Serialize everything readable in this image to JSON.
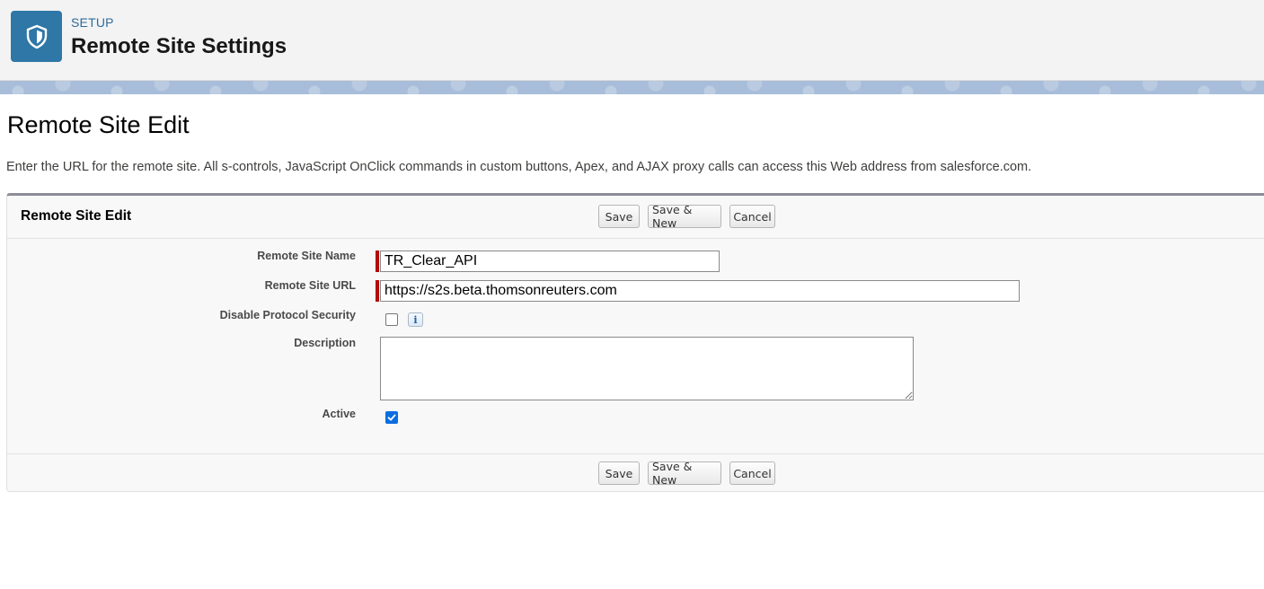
{
  "header": {
    "eyebrow": "SETUP",
    "title": "Remote Site Settings",
    "icon": "shield-icon",
    "icon_bg": "#2e77a6"
  },
  "page": {
    "title": "Remote Site Edit",
    "intro": "Enter the URL for the remote site. All s-controls, JavaScript OnClick commands in custom buttons, Apex, and AJAX proxy calls can access this Web address from salesforce.com."
  },
  "panel": {
    "title": "Remote Site Edit",
    "buttons": {
      "save": "Save",
      "save_new": "Save & New",
      "cancel": "Cancel"
    }
  },
  "form": {
    "remote_site_name": {
      "label": "Remote Site Name",
      "value": "TR_Clear_API",
      "required": true
    },
    "remote_site_url": {
      "label": "Remote Site URL",
      "value": "https://s2s.beta.thomsonreuters.com",
      "required": true
    },
    "disable_protocol_security": {
      "label": "Disable Protocol Security",
      "checked": false,
      "info_icon": "info-icon"
    },
    "description": {
      "label": "Description",
      "value": ""
    },
    "active": {
      "label": "Active",
      "checked": true
    }
  },
  "colors": {
    "required_bar": "#b10a0a",
    "checkbox_checked": "#0b6ee0",
    "link_blue": "#2e6b9a"
  }
}
